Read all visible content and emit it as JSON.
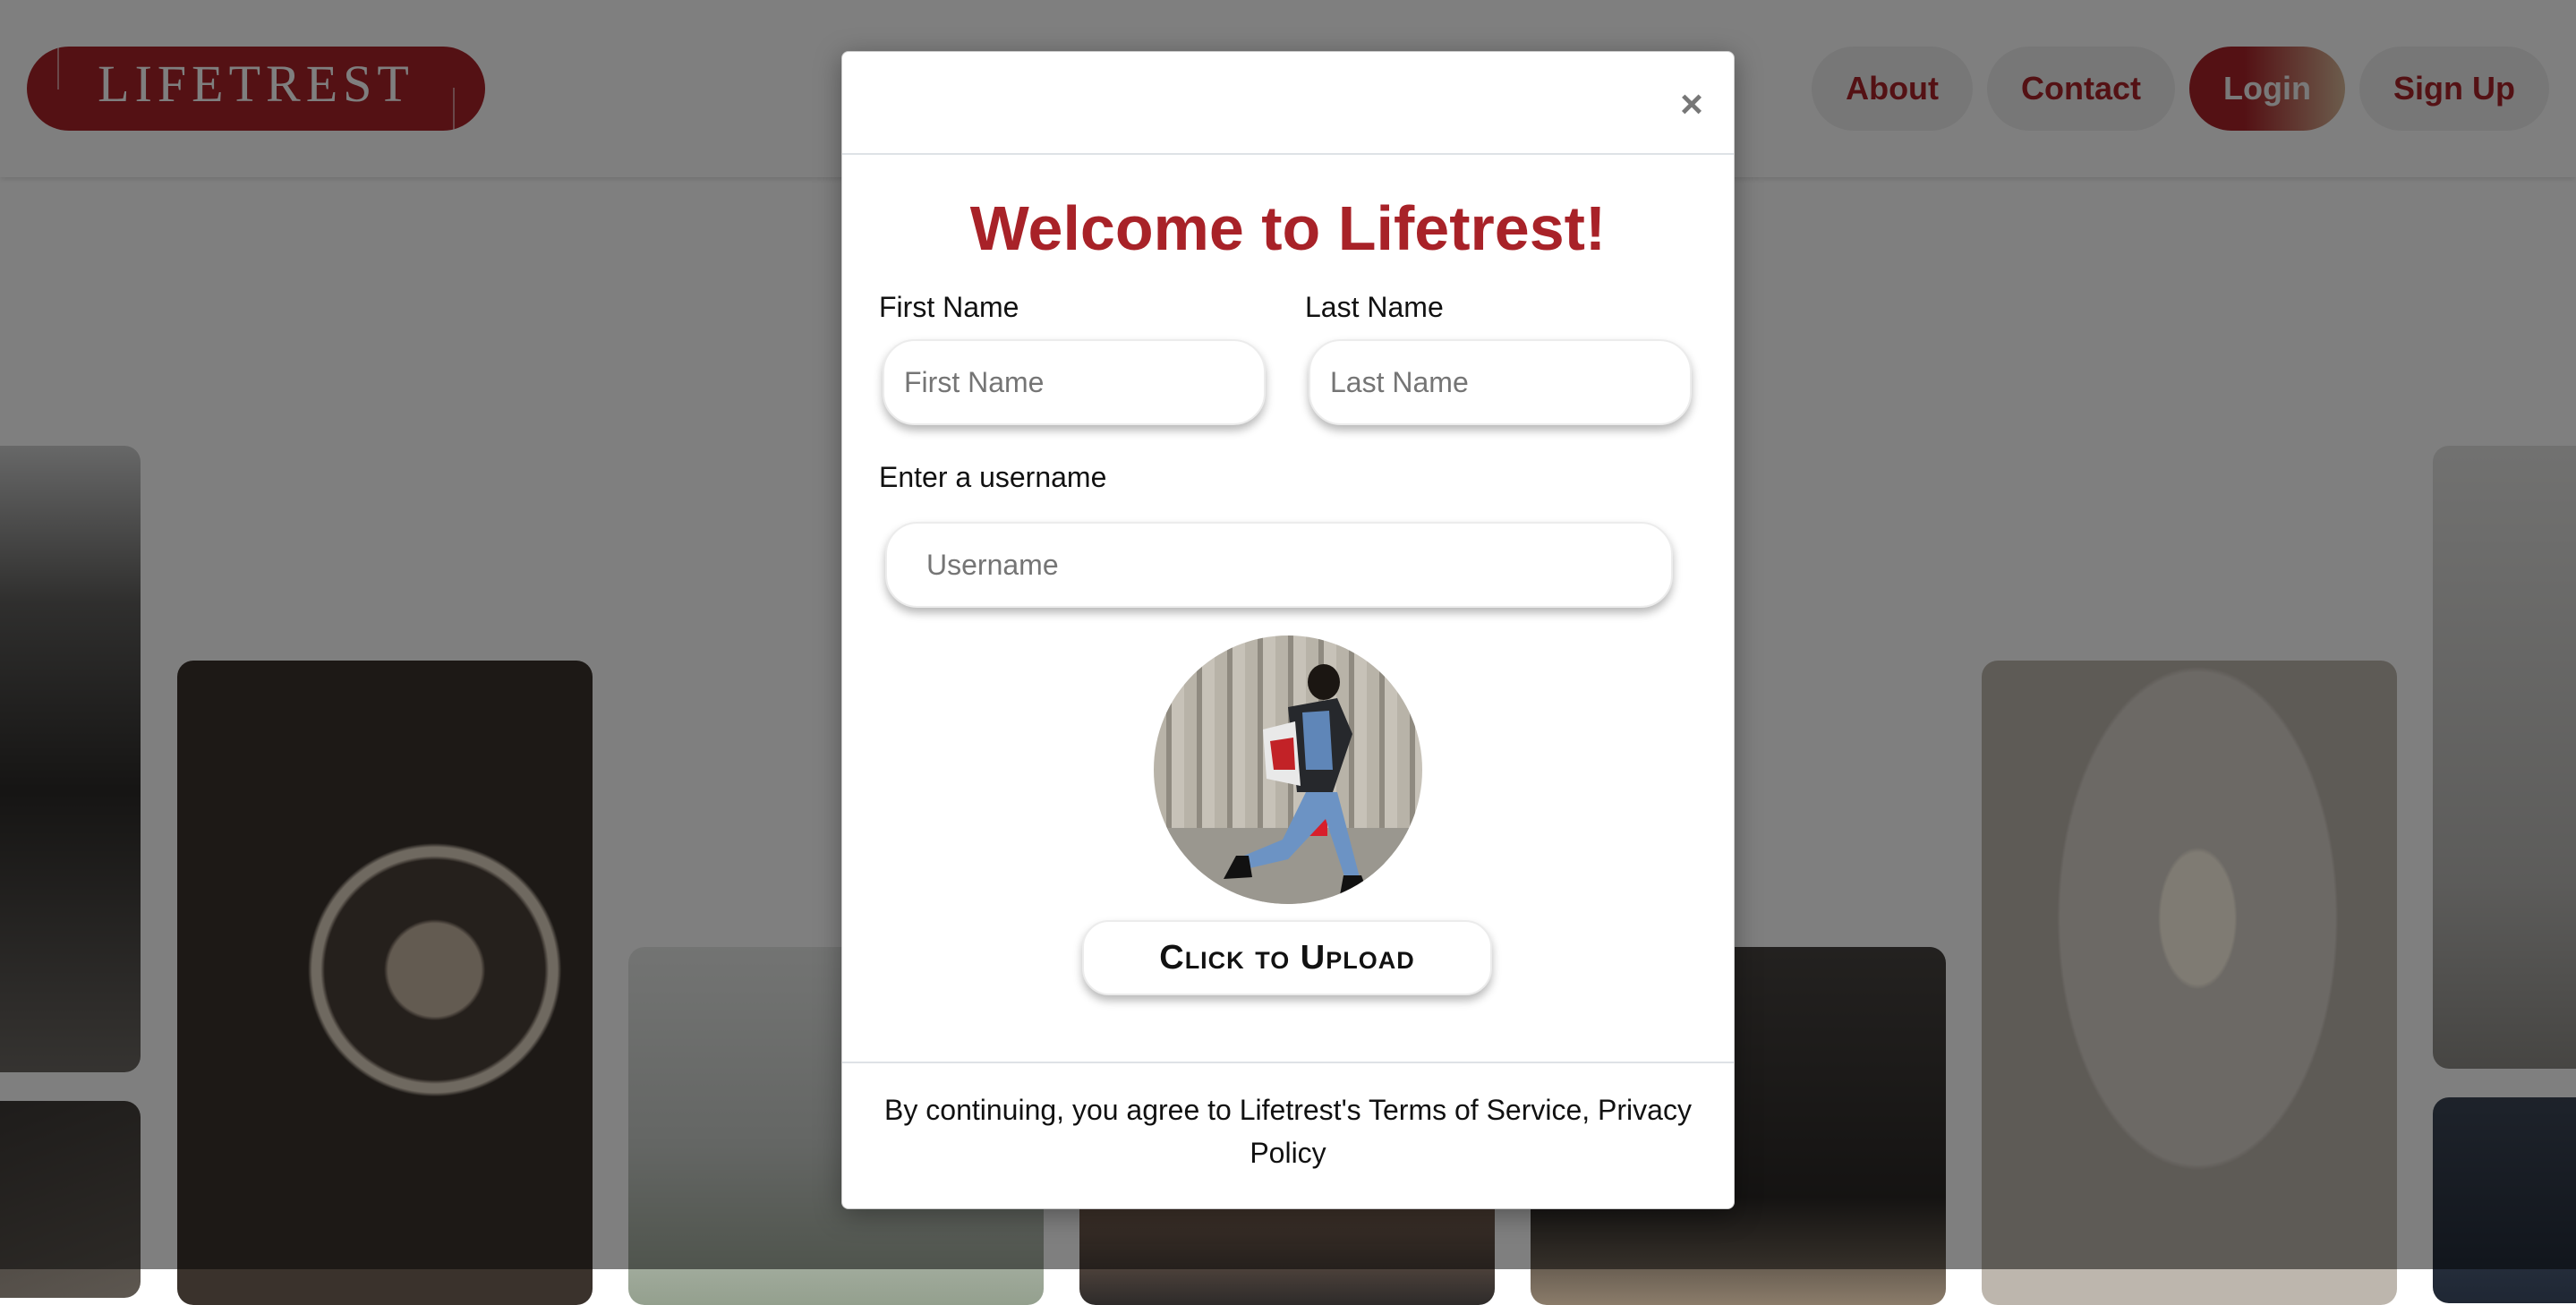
{
  "navbar": {
    "logo_text": "LIFETREST",
    "links": [
      "About",
      "Contact",
      "Login",
      "Sign Up"
    ]
  },
  "modal": {
    "title": "Welcome to Lifetrest!",
    "close_icon": "×",
    "first_name_label": "First Name",
    "first_name_placeholder": "First Name",
    "first_name_value": "",
    "last_name_label": "Last Name",
    "last_name_placeholder": "Last Name",
    "last_name_value": "",
    "username_label": "Enter a username",
    "username_placeholder": "Username",
    "username_value": "",
    "upload_button": "Click to Upload",
    "footer_text": "By continuing, you agree to Lifetrest's Terms of Service, Privacy Policy"
  },
  "colors": {
    "brand": "#a82228",
    "overlay": "rgba(0,0,0,0.5)"
  },
  "icons": {
    "close": "close-icon"
  }
}
